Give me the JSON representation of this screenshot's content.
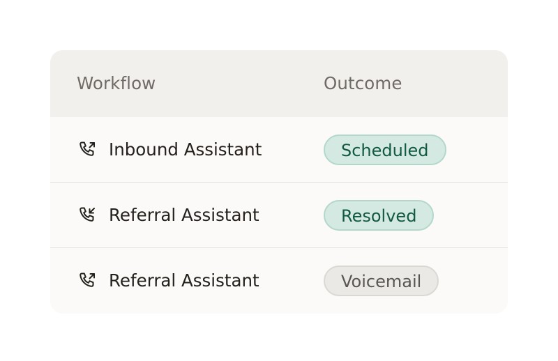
{
  "table": {
    "headers": {
      "workflow": "Workflow",
      "outcome": "Outcome"
    },
    "rows": [
      {
        "icon": "phone-outgoing-icon",
        "workflow": "Inbound Assistant",
        "outcome": "Scheduled",
        "status_color": "green"
      },
      {
        "icon": "phone-incoming-icon",
        "workflow": "Referral Assistant",
        "outcome": "Resolved",
        "status_color": "green"
      },
      {
        "icon": "phone-outgoing-icon",
        "workflow": "Referral Assistant",
        "outcome": "Voicemail",
        "status_color": "gray"
      }
    ]
  },
  "colors": {
    "header_bg": "#f2f0ec",
    "card_bg": "#fbfaf8",
    "success_badge_bg": "#d4e9e1",
    "success_badge_text": "#115a40",
    "neutral_badge_bg": "#ebe9e6",
    "neutral_badge_text": "#595550"
  }
}
